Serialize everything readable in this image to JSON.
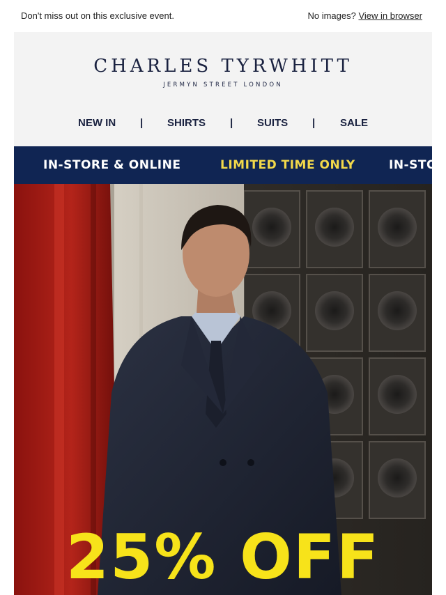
{
  "preheader": {
    "left_text": "Don't miss out on this exclusive event.",
    "right_text": "No images?",
    "view_link": "View in browser"
  },
  "logo": {
    "brand": "CHARLES TYRWHITT",
    "tagline": "JERMYN STREET LONDON"
  },
  "nav": {
    "items": [
      "NEW IN",
      "SHIRTS",
      "SUITS",
      "SALE"
    ],
    "separator": "|"
  },
  "ticker": {
    "items": [
      "IN-STORE & ONLINE",
      "LIMITED TIME ONLY",
      "IN-STO"
    ]
  },
  "hero": {
    "offer": "25% OFF",
    "image": "man-in-navy-suit-photo"
  },
  "colors": {
    "navy": "#102553",
    "ticker_yellow": "#f3d94a",
    "offer_yellow": "#f7e31a",
    "header_bg": "#f3f3f3"
  }
}
